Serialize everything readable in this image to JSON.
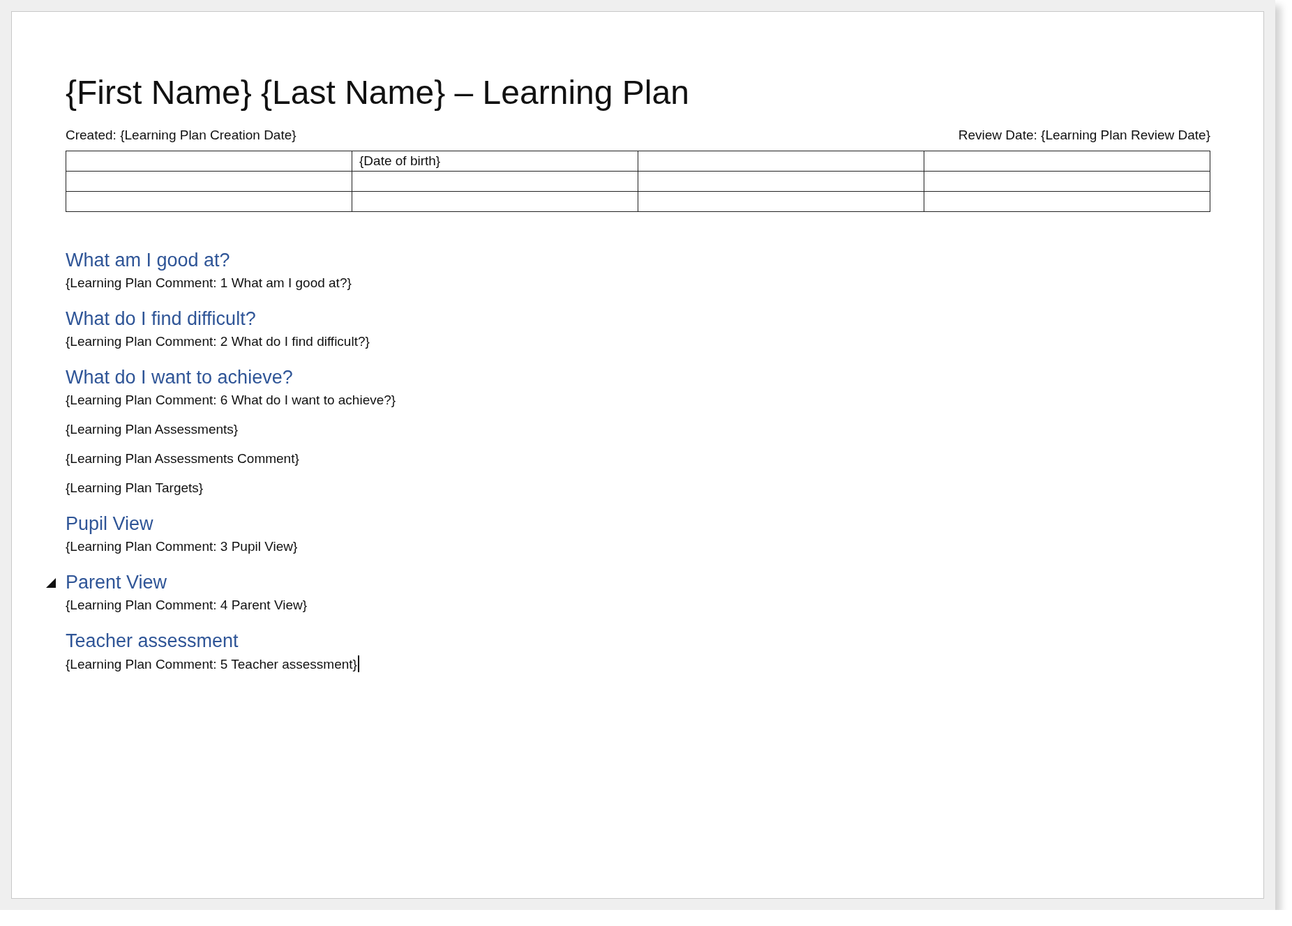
{
  "document": {
    "title": "{First Name} {Last Name} – Learning Plan",
    "created": "Created: {Learning Plan Creation Date}",
    "review": "Review Date: {Learning Plan Review Date}",
    "table": {
      "rows": [
        {
          "cells": [
            null,
            "{Date of birth}",
            null,
            null
          ]
        },
        {
          "cells": [
            null,
            null,
            null,
            null
          ]
        },
        {
          "cells": [
            null,
            null,
            null,
            null
          ]
        }
      ]
    },
    "blocks": [
      {
        "kind": "heading",
        "text": "What am I good at?",
        "toggle_shown": false
      },
      {
        "kind": "paragraph",
        "text": "{Learning Plan Comment: 1 What am I good at?}",
        "caret": false
      },
      {
        "kind": "heading",
        "text": "What do I find difficult?",
        "toggle_shown": false
      },
      {
        "kind": "paragraph",
        "text": "{Learning Plan Comment: 2 What do I find difficult?}",
        "caret": false
      },
      {
        "kind": "heading",
        "text": "What do I want to achieve?",
        "toggle_shown": false
      },
      {
        "kind": "paragraph",
        "text": "{Learning Plan Comment: 6 What do I want to achieve?}",
        "caret": false
      },
      {
        "kind": "paragraph",
        "text": "{Learning Plan Assessments}",
        "caret": false
      },
      {
        "kind": "paragraph",
        "text": "{Learning Plan Assessments Comment}",
        "caret": false
      },
      {
        "kind": "paragraph",
        "text": "{Learning Plan Targets}",
        "caret": false
      },
      {
        "kind": "heading",
        "text": "Pupil View",
        "toggle_shown": false
      },
      {
        "kind": "paragraph",
        "text": "{Learning Plan Comment: 3 Pupil View}",
        "caret": false
      },
      {
        "kind": "heading",
        "text": "Parent View",
        "toggle_shown": true
      },
      {
        "kind": "paragraph",
        "text": "{Learning Plan Comment: 4 Parent View}",
        "caret": false
      },
      {
        "kind": "heading",
        "text": "Teacher assessment",
        "toggle_shown": false
      },
      {
        "kind": "paragraph",
        "text": "{Learning Plan Comment: 5 Teacher assessment}",
        "caret": true
      }
    ]
  }
}
